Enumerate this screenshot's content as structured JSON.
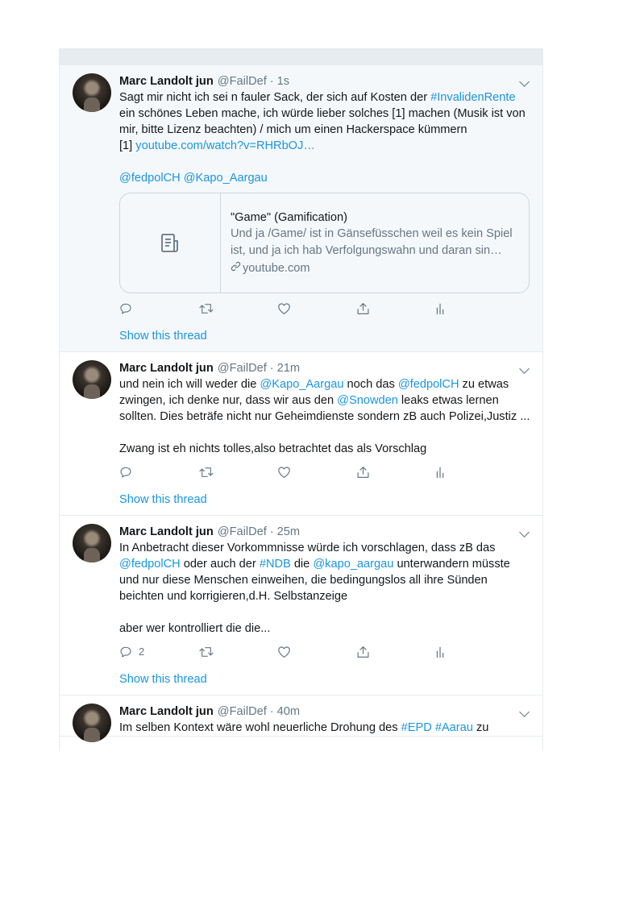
{
  "tweets": [
    {
      "name": "Marc Landolt jun",
      "handle": "@FailDef",
      "time": "1s",
      "text_parts": [
        {
          "t": "Sagt mir nicht ich sei n fauler Sack, der sich auf Kosten der ",
          "link": false
        },
        {
          "t": "#InvalidenRente",
          "link": true
        },
        {
          "t": "\nein schönes Leben mache, ich würde lieber solches [1] machen (Musik ist von mir, bitte Lizenz beachten) / mich um einen Hackerspace kümmern\n[1] ",
          "link": false
        },
        {
          "t": "youtube.com/watch?v=RHRbOJ…",
          "link": true
        },
        {
          "t": "\n\n",
          "link": false
        },
        {
          "t": "@fedpolCH",
          "link": true
        },
        {
          "t": " ",
          "link": false
        },
        {
          "t": "@Kapo_Aargau",
          "link": true
        }
      ],
      "card": {
        "title": "\"Game\" (Gamification)",
        "description": "Und ja /Game/ ist in Gänsefüsschen weil es kein Spiel ist, und ja ich hab Verfolgungswahn und daran sin…",
        "domain": "youtube.com"
      },
      "reply_count": "",
      "show_thread": "Show this thread"
    },
    {
      "name": "Marc Landolt jun",
      "handle": "@FailDef",
      "time": "21m",
      "text_parts": [
        {
          "t": "und nein ich will weder die ",
          "link": false
        },
        {
          "t": "@Kapo_Aargau",
          "link": true
        },
        {
          "t": " noch das ",
          "link": false
        },
        {
          "t": "@fedpolCH",
          "link": true
        },
        {
          "t": " zu etwas zwingen, ich denke nur, dass wir aus den ",
          "link": false
        },
        {
          "t": "@Snowden",
          "link": true
        },
        {
          "t": " leaks etwas lernen sollten. Dies beträfe nicht nur Geheimdienste sondern zB auch Polizei,Justiz ...\n\nZwang ist eh nichts tolles,also betrachtet das als Vorschlag",
          "link": false
        }
      ],
      "reply_count": "",
      "show_thread": "Show this thread"
    },
    {
      "name": "Marc Landolt jun",
      "handle": "@FailDef",
      "time": "25m",
      "text_parts": [
        {
          "t": "In Anbetracht dieser Vorkommnisse würde ich vorschlagen, dass zB das ",
          "link": false
        },
        {
          "t": "@fedpolCH",
          "link": true
        },
        {
          "t": " oder auch der ",
          "link": false
        },
        {
          "t": "#NDB",
          "link": true
        },
        {
          "t": " die ",
          "link": false
        },
        {
          "t": "@kapo_aargau",
          "link": true
        },
        {
          "t": " unterwandern müsste und nur diese Menschen einweihen, die bedingungslos all ihre Sünden beichten und korrigieren,d.H. Selbstanzeige\n\naber wer kontrolliert die die...",
          "link": false
        }
      ],
      "reply_count": "2",
      "show_thread": "Show this thread"
    },
    {
      "name": "Marc Landolt jun",
      "handle": "@FailDef",
      "time": "40m",
      "text_parts": [
        {
          "t": "Im selben Kontext wäre wohl neuerliche Drohung des ",
          "link": false
        },
        {
          "t": "#EPD",
          "link": true
        },
        {
          "t": " ",
          "link": false
        },
        {
          "t": "#Aarau",
          "link": true
        },
        {
          "t": " zu",
          "link": false
        }
      ],
      "reply_count": "",
      "show_thread": ""
    }
  ],
  "icons": [
    "reply-icon",
    "retweet-icon",
    "like-icon",
    "share-icon",
    "analytics-icon",
    "article-icon",
    "link-icon",
    "chevron-down-icon"
  ],
  "colors": {
    "link": "#1b95e0",
    "muted": "#657786",
    "text": "#14171a",
    "highlight_bg": "#f5f8fa",
    "border": "#e6ecf0"
  }
}
